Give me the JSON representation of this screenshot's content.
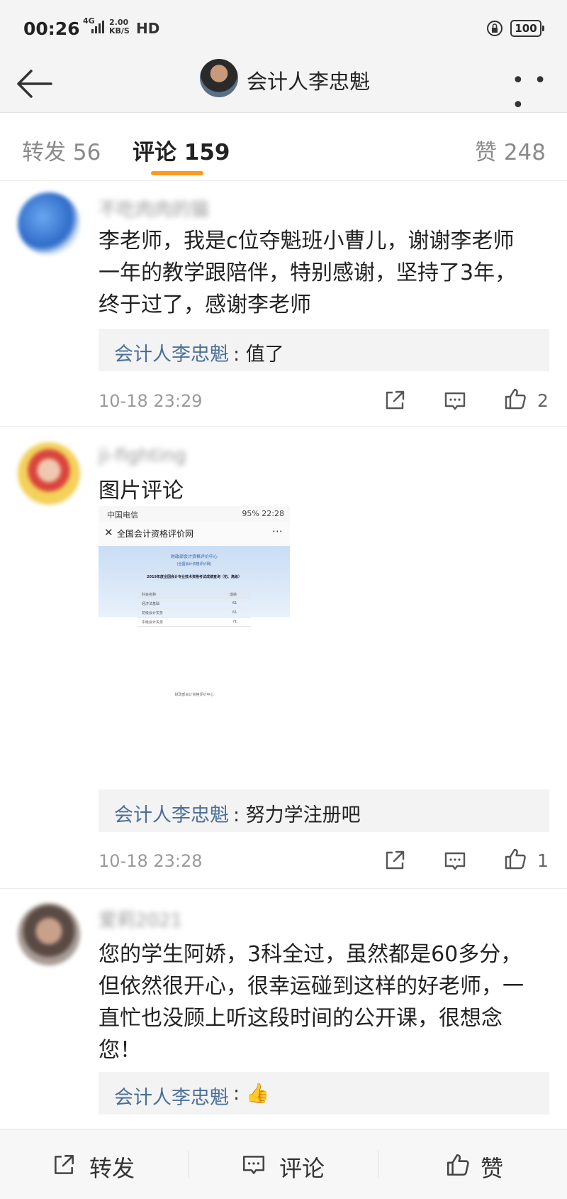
{
  "status_bar": {
    "time": "00:26",
    "network_type": "4G",
    "speed_value": "2.00",
    "speed_unit": "KB/S",
    "hd_label": "HD",
    "battery": "100"
  },
  "nav": {
    "title": "会计人李忠魁",
    "more_icon": "more-icon",
    "back_icon": "back-arrow-icon"
  },
  "tabs": {
    "repost": "转发 56",
    "comment": "评论 159",
    "like": "赞 248",
    "active_color": "#ff9a1e"
  },
  "comments": [
    {
      "username": "不吃肉肉的猫",
      "text": "李老师，我是c位夺魁班小曹儿，谢谢李老师一年的教学跟陪伴，特别感谢，坚持了3年，终于过了，感谢李老师",
      "reply_author": "会计人李忠魁",
      "reply_text": "值了",
      "time": "10-18 23:29",
      "likes": "2"
    },
    {
      "username": "ji-fighting",
      "text": "图片评论",
      "image": {
        "status_left": "中国电信",
        "status_right": "95% 22:28",
        "header_title": "全国会计资格评价网",
        "banner_line1": "财政部会计资格评价中心",
        "banner_line2": "(全国会计资格评价网)",
        "banner_line3": "2019年度全国会计专业技术资格考试成绩查询（初、高级）",
        "table_header": [
          "科目名称",
          "成绩"
        ],
        "table_rows": [
          [
            "经济法基础",
            "61"
          ],
          [
            "初级会计实务",
            "61"
          ],
          [
            "中级会计实务",
            "71"
          ]
        ]
      },
      "reply_author": "会计人李忠魁",
      "reply_text": "努力学注册吧",
      "time": "10-18 23:28",
      "likes": "1"
    },
    {
      "username": "爱莉2021",
      "text": "您的学生阿娇，3科全过，虽然都是60多分，但依然很开心，很幸运碰到这样的好老师，一直忙也没顾上听这段时间的公开课，很想念您！",
      "reply_author": "会计人李忠魁",
      "reply_emoji": "👍"
    }
  ],
  "bottom_bar": {
    "repost": "转发",
    "comment": "评论",
    "like": "赞"
  },
  "colors": {
    "link_blue": "#4b6f9a",
    "meta_gray": "#9a9a9a",
    "tab_accent": "#ff9a1e"
  }
}
